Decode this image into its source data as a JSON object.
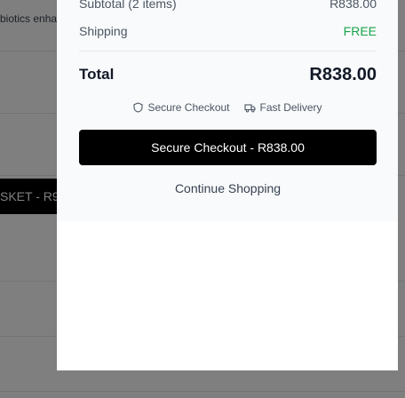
{
  "background": {
    "product_snippet": "biotics enha",
    "button_label": "SKET - R9"
  },
  "summary": {
    "subtotal_label": "Subtotal (2 items)",
    "subtotal_value": "R838.00",
    "shipping_label": "Shipping",
    "shipping_value": "FREE",
    "total_label": "Total",
    "total_value": "R838.00",
    "badge_secure": "Secure Checkout",
    "badge_delivery": "Fast Delivery",
    "checkout_button": "Secure Checkout - R838.00",
    "continue_link": "Continue Shopping"
  },
  "colors": {
    "accent_free": "#16a34a",
    "primary_button": "#000000",
    "summary_bg": "#f9fafb"
  },
  "icons": {
    "secure": "shield-icon",
    "delivery": "truck-icon"
  }
}
